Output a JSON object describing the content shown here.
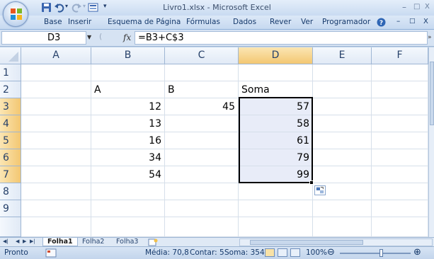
{
  "titlebar": {
    "title": "Livro1.xlsx - Microsoft Excel",
    "minimize": "–",
    "maximize": "□",
    "close": "X"
  },
  "ribbon": {
    "tabs": [
      "Base",
      "Inserir",
      "Esquema de Página",
      "Fórmulas",
      "Dados",
      "Rever",
      "Ver",
      "Programador"
    ],
    "minimize": "–",
    "restore": "□",
    "close": "X"
  },
  "formula_bar": {
    "name_box": "D3",
    "fx": "fx",
    "formula": "=B3+C$3"
  },
  "grid": {
    "columns": [
      "A",
      "B",
      "C",
      "D",
      "E",
      "F"
    ],
    "rows": [
      "1",
      "2",
      "3",
      "4",
      "5",
      "6",
      "7",
      "8",
      "9"
    ],
    "active_column": "D",
    "active_rows": [
      "3",
      "4",
      "5",
      "6",
      "7"
    ],
    "cells": {
      "B2": "A",
      "C2": "B",
      "D2": "Soma",
      "B3": "12",
      "C3": "45",
      "D3": "57",
      "B4": "13",
      "D4": "58",
      "B5": "16",
      "D5": "61",
      "B6": "34",
      "D6": "79",
      "B7": "54",
      "D7": "99"
    }
  },
  "sheets": {
    "tabs": [
      "Folha1",
      "Folha2",
      "Folha3"
    ],
    "active": "Folha1"
  },
  "statusbar": {
    "mode": "Pronto",
    "average": "Média: 70,8",
    "count": "Contar: 5",
    "sum": "Soma: 354",
    "zoom": "100%",
    "zoom_level": 1.0
  },
  "colors": {
    "header_active": "#f3c772",
    "selection_fill": "#e8ecf8",
    "ribbon_bg": "#c6d9f0"
  }
}
